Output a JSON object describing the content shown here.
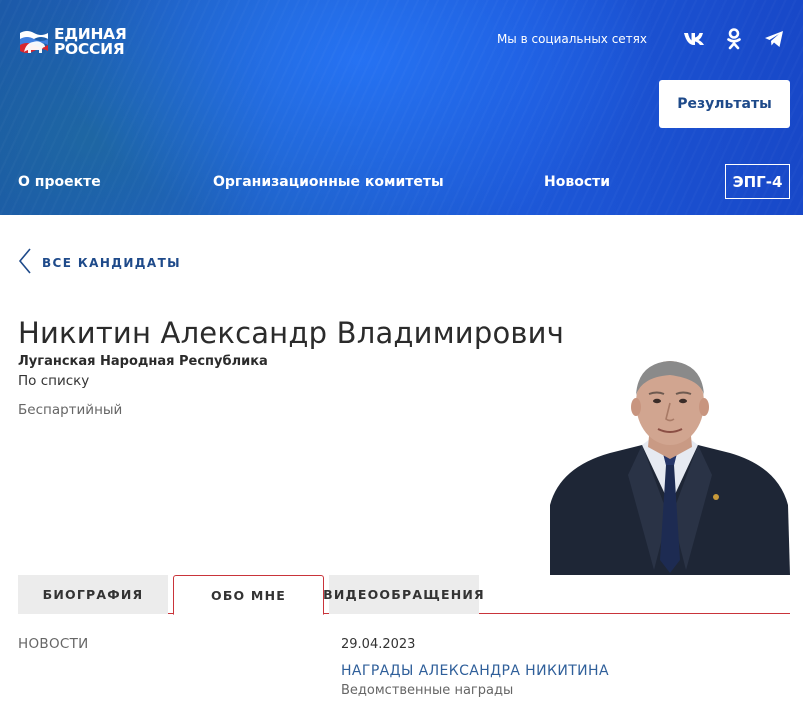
{
  "header": {
    "logo_line1": "ЕДИНАЯ",
    "logo_line2": "РОССИЯ",
    "social_label": "Мы в социальных сетях",
    "social_icons": [
      "vk-icon",
      "odnoklassniki-icon",
      "telegram-icon"
    ],
    "results_button": "Результаты",
    "nav": [
      "О проекте",
      "Организационные комитеты",
      "Новости"
    ],
    "epg_button": "ЭПГ-4"
  },
  "back_link": "ВСЕ КАНДИДАТЫ",
  "candidate": {
    "name": "Никитин Александр Владимирович",
    "region": "Луганская Народная Республика",
    "list": "По списку",
    "party": "Беспартийный"
  },
  "tabs": [
    {
      "label": "БИОГРАФИЯ",
      "active": false
    },
    {
      "label": "ОБО МНЕ",
      "active": true
    },
    {
      "label": "ВИДЕООБРАЩЕНИЯ",
      "active": false
    }
  ],
  "news": {
    "heading": "НОВОСТИ",
    "items": [
      {
        "date": "29.04.2023",
        "title": "НАГРАДЫ АЛЕКСАНДРА НИКИТИНА",
        "subtitle": "Ведомственные награды"
      }
    ]
  },
  "colors": {
    "header_blue": "#1f63c9",
    "accent_red": "#c9343a",
    "link_blue": "#1e4a8a"
  }
}
